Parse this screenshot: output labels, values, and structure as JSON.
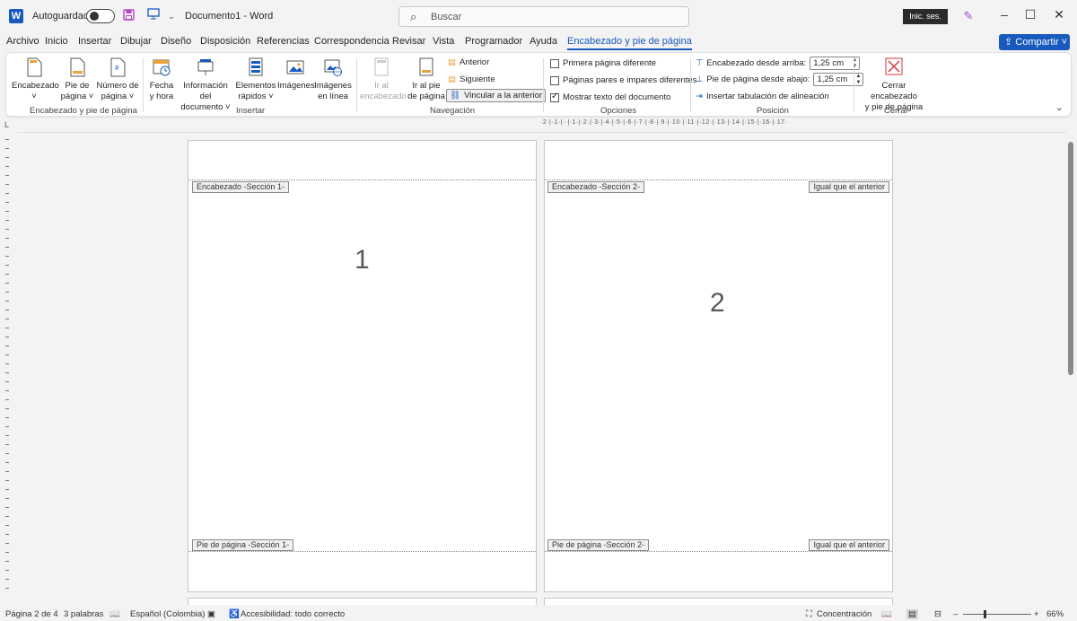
{
  "titlebar": {
    "app_icon": "W",
    "autosave_label": "Autoguardado",
    "doc_title": "Documento1  -  Word",
    "search_placeholder": "Buscar",
    "signin": "Inic. ses.",
    "icons": [
      "save-icon",
      "present-icon",
      "search-icon",
      "pen-icon",
      "minimize-icon",
      "maximize-icon",
      "close-icon"
    ]
  },
  "menu": {
    "tabs": [
      "Archivo",
      "Inicio",
      "Insertar",
      "Dibujar",
      "Diseño",
      "Disposición",
      "Referencias",
      "Correspondencia",
      "Revisar",
      "Vista",
      "Programador",
      "Ayuda",
      "Encabezado y pie de página"
    ],
    "active": "Encabezado y pie de página",
    "share": "Compartir"
  },
  "ribbon": {
    "group1": {
      "label": "Encabezado y pie de página",
      "b1a": "Encabezado",
      "b1b": "˅",
      "b2a": "Pie de",
      "b2b": "página ˅",
      "b3a": "Número de",
      "b3b": "página ˅"
    },
    "group2": {
      "label": "Insertar",
      "b1a": "Fecha",
      "b1b": "y hora",
      "b2a": "Información del",
      "b2b": "documento ˅",
      "b3a": "Elementos",
      "b3b": "rápidos ˅",
      "b4a": "Imágenes",
      "b5a": "Imágenes",
      "b5b": "en línea"
    },
    "group3": {
      "label": "Navegación",
      "b1a": "Ir al",
      "b1b": "encabezado",
      "b2a": "Ir al pie",
      "b2b": "de página",
      "prev": "Anterior",
      "next": "Siguiente",
      "link": "Vincular a la anterior"
    },
    "group4": {
      "label": "Opciones",
      "opt1": "Primera página diferente",
      "opt2": "Páginas pares e impares diferentes",
      "opt3": "Mostrar texto del documento",
      "checked": [
        false,
        false,
        true
      ]
    },
    "group5": {
      "label": "Posición",
      "header_from_top": "Encabezado desde arriba:",
      "header_value": "1,25 cm",
      "footer_from_bottom": "Pie de página desde abajo:",
      "footer_value": "1,25 cm",
      "insert_tab": "Insertar tabulación de alineación"
    },
    "group6": {
      "label": "Cerrar",
      "b1a": "Cerrar encabezado",
      "b1b": "y pie de página"
    }
  },
  "ruler": {
    "text": "·2·|·1·|··|·1·|·2·|·3·|·4·|·5·|·6·|·7·|·8·|·9·|·10·|·11·|·12·|·13·|·14·|·15·|·16·|·17·"
  },
  "pages": [
    {
      "header_tag": "Encabezado -Sección 1-",
      "footer_tag": "Pie de página -Sección 1-",
      "number": "1",
      "same_as_prev": ""
    },
    {
      "header_tag": "Encabezado -Sección 2-",
      "footer_tag": "Pie de página -Sección 2-",
      "number": "2",
      "same_as_prev": "Igual que el anterior"
    }
  ],
  "status": {
    "page": "Página 2 de 4",
    "words": "3 palabras",
    "language": "Español (Colombia)",
    "accessibility": "Accesibilidad: todo correcto",
    "focus": "Concentración",
    "zoom": "66%"
  },
  "colors": {
    "accent": "#185abd",
    "autosave_save_icon": "#b146c2"
  }
}
